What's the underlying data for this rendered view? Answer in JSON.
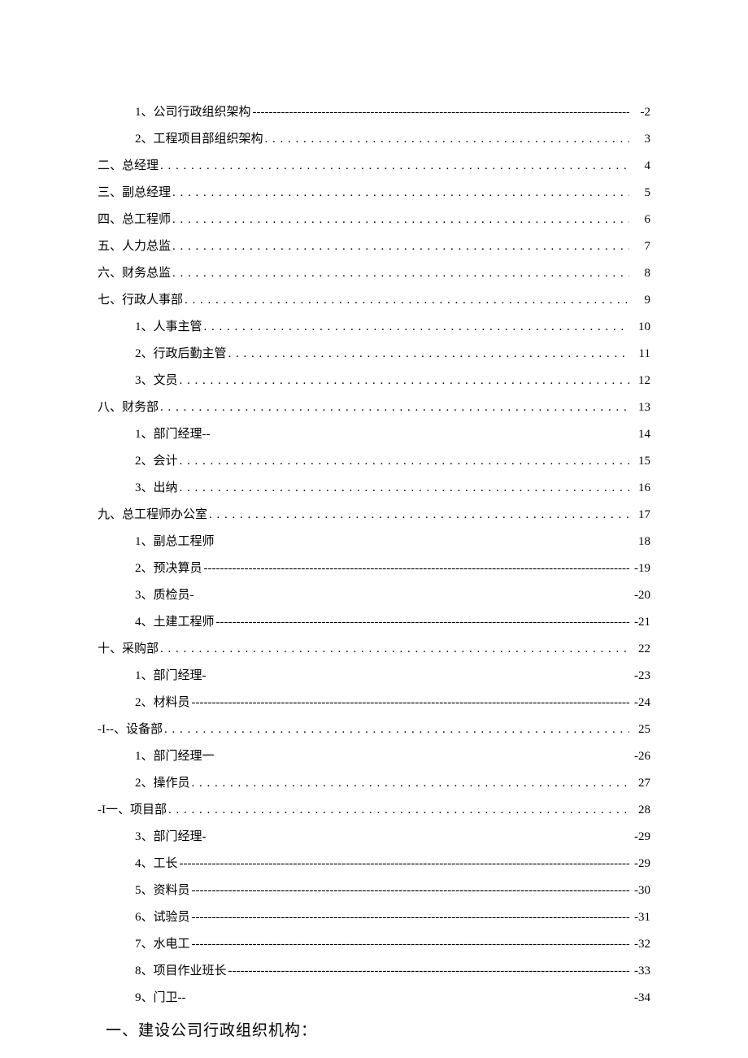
{
  "toc": [
    {
      "level": 2,
      "label": "1、公司行政组织架构 ",
      "leader": "dashes",
      "suffix": "",
      "page": "-2"
    },
    {
      "level": 2,
      "label": "2、工程项目部组织架构",
      "leader": "dots",
      "suffix": "",
      "page": "3"
    },
    {
      "level": 1,
      "label": "二、总经理",
      "leader": "dots",
      "suffix": "",
      "page": "4"
    },
    {
      "level": 1,
      "label": "三、副总经理",
      "leader": "dots",
      "suffix": "",
      "page": "5"
    },
    {
      "level": 1,
      "label": "四、总工程师",
      "leader": "dots",
      "suffix": "",
      "page": "6"
    },
    {
      "level": 1,
      "label": "五、人力总监",
      "leader": "dots",
      "suffix": "",
      "page": "7"
    },
    {
      "level": 1,
      "label": "六、财务总监",
      "leader": "dots",
      "suffix": "",
      "page": "8"
    },
    {
      "level": 1,
      "label": "七、行政人事部",
      "leader": "dots",
      "suffix": "",
      "page": "9"
    },
    {
      "level": 2,
      "label": "1、人事主管",
      "leader": "dots",
      "suffix": "",
      "page": "10"
    },
    {
      "level": 2,
      "label": "2、行政后勤主管",
      "leader": "dots",
      "suffix": "",
      "page": "11"
    },
    {
      "level": 2,
      "label": "3、文员",
      "leader": "dots",
      "suffix": "",
      "page": "12"
    },
    {
      "level": 1,
      "label": "八、财务部",
      "leader": "dots",
      "suffix": "",
      "page": "13"
    },
    {
      "level": 2,
      "label": "1、部门经理--",
      "leader": "blank",
      "suffix": "",
      "page": "14"
    },
    {
      "level": 2,
      "label": "2、会计",
      "leader": "dots",
      "suffix": "",
      "page": "15"
    },
    {
      "level": 2,
      "label": "3、出纳",
      "leader": "dots",
      "suffix": "",
      "page": "16"
    },
    {
      "level": 1,
      "label": "九、总工程师办公室",
      "leader": "dots",
      "suffix": "",
      "page": "17"
    },
    {
      "level": 2,
      "label": "1、副总工程师",
      "leader": "blank",
      "suffix": "",
      "page": "18"
    },
    {
      "level": 2,
      "label": "2、预决算员 ",
      "leader": "dashes",
      "suffix": "",
      "page": "-19"
    },
    {
      "level": 2,
      "label": "3、质检员-",
      "leader": "blank",
      "suffix": "",
      "page": "-20"
    },
    {
      "level": 2,
      "label": "4、土建工程师",
      "leader": "dashes",
      "suffix": "",
      "page": "-21"
    },
    {
      "level": 1,
      "label": "十、采购部",
      "leader": "dots",
      "suffix": "",
      "page": "22"
    },
    {
      "level": 2,
      "label": "1、部门经理-",
      "leader": "blank",
      "suffix": "",
      "page": "-23"
    },
    {
      "level": 2,
      "label": "2、材料员 ",
      "leader": "dashes",
      "suffix": "",
      "page": "-24"
    },
    {
      "level": 1,
      "label": "-I--、设备部",
      "leader": "dots",
      "suffix": "",
      "page": "25"
    },
    {
      "level": 2,
      "label": "1、部门经理一",
      "leader": "blank",
      "suffix": "",
      "page": "-26"
    },
    {
      "level": 2,
      "label": "2、操作员",
      "leader": "dots",
      "suffix": "",
      "page": "27"
    },
    {
      "level": 1,
      "label": "-I一、项目部",
      "leader": "dots",
      "suffix": "",
      "page": "28"
    },
    {
      "level": 2,
      "label": "3、部门经理-",
      "leader": "blank",
      "suffix": "",
      "page": "-29"
    },
    {
      "level": 2,
      "label": "4、工长 ",
      "leader": "dashes",
      "suffix": "",
      "page": "-29"
    },
    {
      "level": 2,
      "label": "5、资料员 ",
      "leader": "dashes",
      "suffix": "",
      "page": "-30"
    },
    {
      "level": 2,
      "label": "6、试验员 ",
      "leader": "dashes",
      "suffix": "",
      "page": "-31"
    },
    {
      "level": 2,
      "label": "7、水电工 ",
      "leader": "dashes",
      "suffix": "",
      "page": "-32"
    },
    {
      "level": 2,
      "label": "8、项目作业班长",
      "leader": "dashes",
      "suffix": "",
      "page": "-33"
    },
    {
      "level": 2,
      "label": "9、门卫--",
      "leader": "blank",
      "suffix": "",
      "page": "-34"
    }
  ],
  "heading": "一、建设公司行政组织机构："
}
